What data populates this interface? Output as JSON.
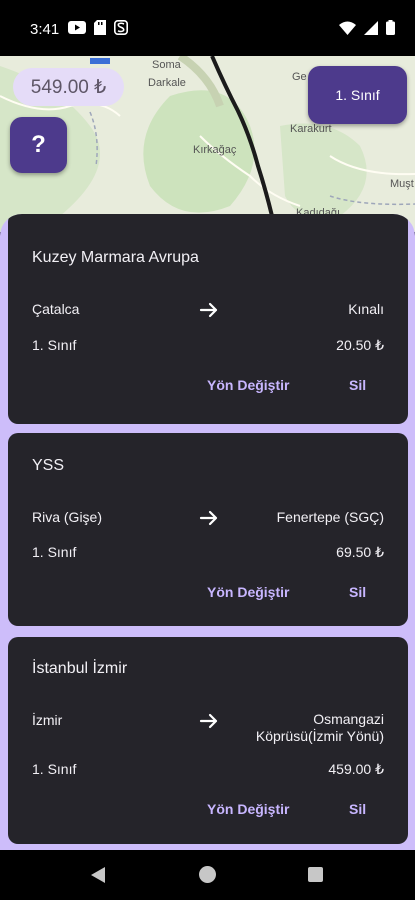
{
  "status_bar": {
    "time": "3:41",
    "left_icons": [
      "youtube-icon",
      "sd-card-icon",
      "s-logo-icon"
    ],
    "right_icons": [
      "wifi-icon",
      "cellular-icon",
      "battery-icon"
    ]
  },
  "map": {
    "labels": [
      "Soma",
      "Darkale",
      "Kırkağaç",
      "Karakurt",
      "Muşt",
      "Kadıdağı",
      "Ge"
    ],
    "route_color": "#1b1b1b",
    "land_color": "#e8ecdc",
    "forest_color": "#cde3bd"
  },
  "overlay": {
    "price": "549.00 ₺",
    "help_label": "?",
    "class_label": "1. Sınıf"
  },
  "routes": [
    {
      "title": "Kuzey Marmara Avrupa",
      "from": "Çatalca",
      "to": "Kınalı",
      "class": "1. Sınıf",
      "price": "20.50 ₺",
      "reverse_label": "Yön Değiştir",
      "delete_label": "Sil"
    },
    {
      "title": "YSS",
      "from": "Riva (Gişe)",
      "to": "Fenertepe (SGÇ)",
      "class": "1. Sınıf",
      "price": "69.50 ₺",
      "reverse_label": "Yön Değiştir",
      "delete_label": "Sil"
    },
    {
      "title": "İstanbul İzmir",
      "from": "İzmir",
      "to_line1": "Osmangazi",
      "to_line2": "Köprüsü(İzmir Yönü)",
      "class": "1. Sınıf",
      "price": "459.00 ₺",
      "reverse_label": "Yön Değiştir",
      "delete_label": "Sil"
    }
  ],
  "colors": {
    "accent_purple": "#4d3a8c",
    "sheet_background": "#cdbdfa",
    "card_background": "#25242a",
    "action_text": "#c8b6ff"
  }
}
